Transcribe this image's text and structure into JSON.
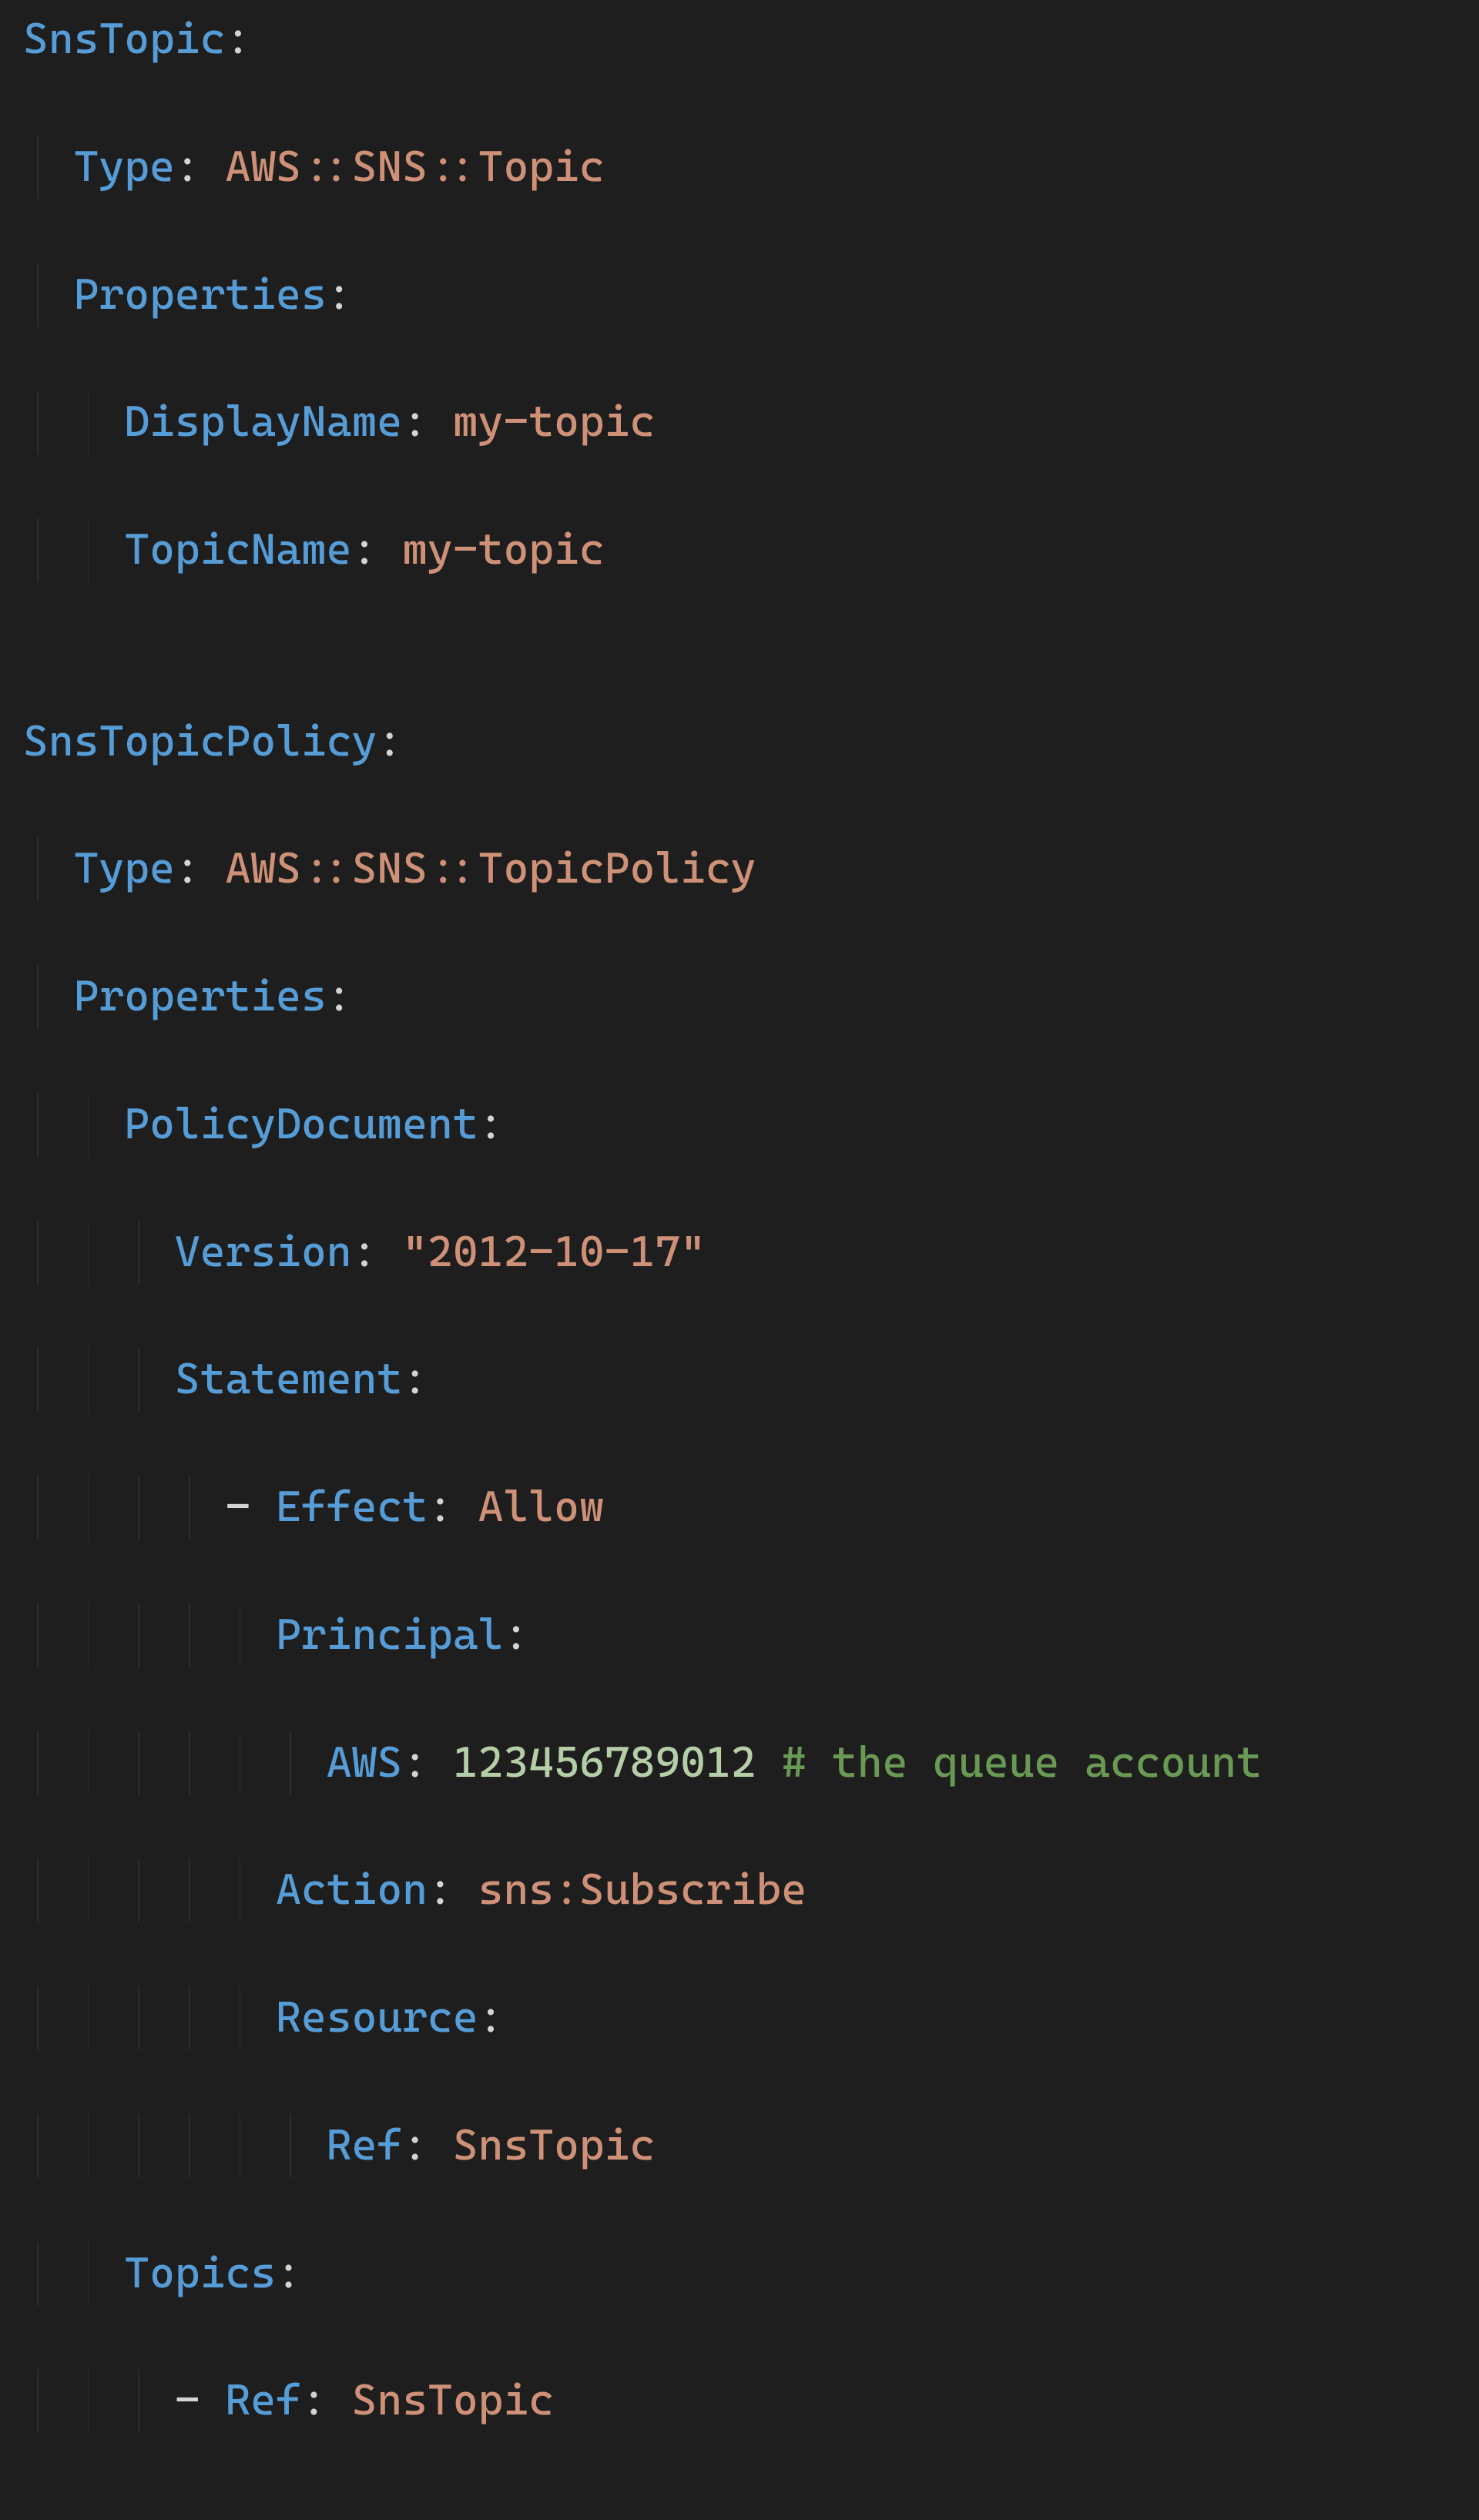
{
  "code": {
    "l1": {
      "key": "SnsTopic",
      "colon": ":"
    },
    "l2": {
      "key": "Type",
      "colon": ": ",
      "value": "AWS::SNS::Topic"
    },
    "l3": {
      "key": "Properties",
      "colon": ":"
    },
    "l4": {
      "key": "DisplayName",
      "colon": ": ",
      "value": "my-topic"
    },
    "l5": {
      "key": "TopicName",
      "colon": ": ",
      "value": "my-topic"
    },
    "l6": {
      "blank": ""
    },
    "l7": {
      "key": "SnsTopicPolicy",
      "colon": ":"
    },
    "l8": {
      "key": "Type",
      "colon": ": ",
      "value": "AWS::SNS::TopicPolicy"
    },
    "l9": {
      "key": "Properties",
      "colon": ":"
    },
    "l10": {
      "key": "PolicyDocument",
      "colon": ":"
    },
    "l11": {
      "key": "Version",
      "colon": ": ",
      "value": "\"2012-10-17\""
    },
    "l12": {
      "key": "Statement",
      "colon": ":"
    },
    "l13": {
      "dash": "- ",
      "key": "Effect",
      "colon": ": ",
      "value": "Allow"
    },
    "l14": {
      "key": "Principal",
      "colon": ":"
    },
    "l15": {
      "key": "AWS",
      "colon": ": ",
      "value": "123456789012",
      "comment": " # the queue account"
    },
    "l16": {
      "key": "Action",
      "colon": ": ",
      "value": "sns:Subscribe"
    },
    "l17": {
      "key": "Resource",
      "colon": ":"
    },
    "l18": {
      "key": "Ref",
      "colon": ": ",
      "value": "SnsTopic"
    },
    "l19": {
      "key": "Topics",
      "colon": ":"
    },
    "l20": {
      "dash": "- ",
      "key": "Ref",
      "colon": ": ",
      "value": "SnsTopic"
    }
  }
}
